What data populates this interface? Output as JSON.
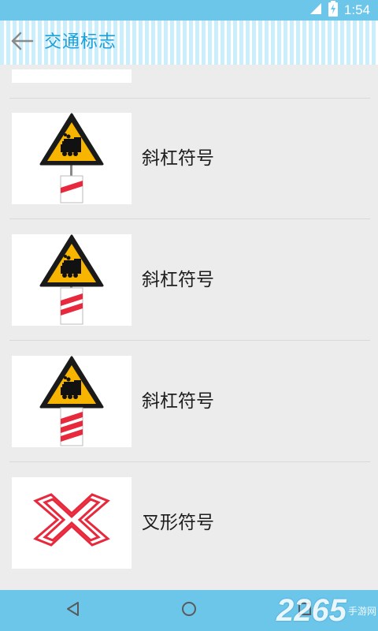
{
  "status_bar": {
    "time": "1:54",
    "icons": [
      "signal-icon",
      "battery-charging-icon"
    ]
  },
  "app_bar": {
    "back_icon": "arrow-left-icon",
    "title": "交通标志"
  },
  "list": {
    "items": [
      {
        "label": "斜杠符号",
        "sign": "railway-warning-one-stripe"
      },
      {
        "label": "斜杠符号",
        "sign": "railway-warning-two-stripes"
      },
      {
        "label": "斜杠符号",
        "sign": "railway-warning-three-stripes"
      },
      {
        "label": "叉形符号",
        "sign": "railway-crossing-x-symbol"
      }
    ]
  },
  "nav_bar": {
    "back": "nav-back-icon",
    "home": "nav-home-icon",
    "recents": "nav-recents-icon"
  },
  "watermark": {
    "digits": "2265",
    "text": "手游网"
  },
  "colors": {
    "status_bar": "#6cc6ea",
    "title": "#1a9fd8",
    "sign_yellow": "#f7b500",
    "stripe_red": "#e8283c"
  }
}
